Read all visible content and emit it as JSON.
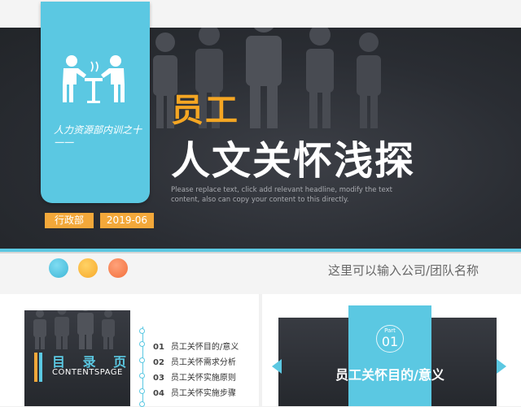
{
  "cover": {
    "subtitle": "人力资源部内训之十一一",
    "department": "行政部",
    "date": "2019-06",
    "title_small": "员工",
    "title_big": "人文关怀浅探",
    "description": "Please replace text, click add relevant headline, modify the text content, also can copy your content to this directly.",
    "company": "这里可以输入公司/团队名称",
    "dots": [
      "#5bc8e2",
      "#f7a92a",
      "#f26f3c"
    ]
  },
  "toc": {
    "title": "目 录 页",
    "subtitle": "CONTENTSPAGE",
    "items": [
      {
        "num": "01",
        "label": "员工关怀目的/意义"
      },
      {
        "num": "02",
        "label": "员工关怀需求分析"
      },
      {
        "num": "03",
        "label": "员工关怀实施原则"
      },
      {
        "num": "04",
        "label": "员工关怀实施步骤"
      }
    ]
  },
  "part": {
    "label": "Part",
    "number": "01",
    "title": "员工关怀目的/意义"
  },
  "colors": {
    "accent_blue": "#5bc8e2",
    "accent_orange": "#f3a83a",
    "dark": "#2a2d33"
  },
  "icons": [
    "meeting-people-icon",
    "arrow-left-icon",
    "arrow-right-icon"
  ]
}
